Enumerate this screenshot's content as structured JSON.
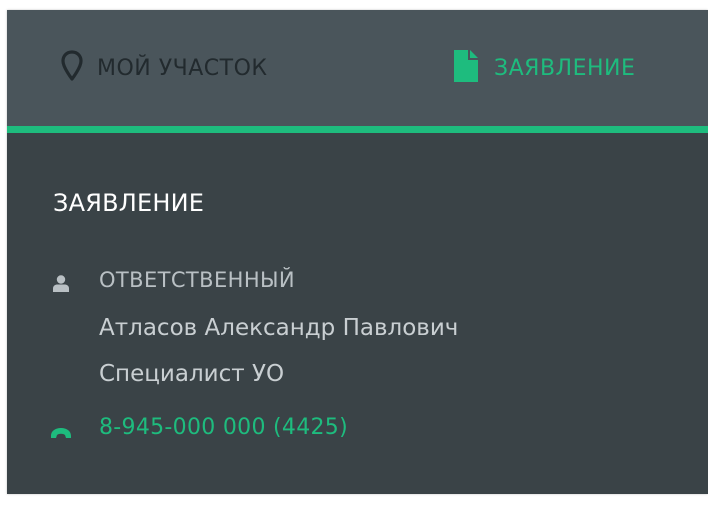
{
  "tabs": [
    {
      "label": "МОЙ УЧАСТОК",
      "icon": "map-marker-icon",
      "active": false
    },
    {
      "label": "ЗАЯВЛЕНИЕ",
      "icon": "document-icon",
      "active": true
    }
  ],
  "section": {
    "title": "ЗАЯВЛЕНИЕ",
    "responsible": {
      "label": "ОТВЕТСТВЕННЫЙ",
      "name": "Атласов Александр Павлович",
      "role": "Специалист УО",
      "phone": "8-945-000 000 (4425)"
    }
  },
  "colors": {
    "accent": "#1ebc7e",
    "tabbar_bg": "#4a555b",
    "panel_bg": "#3a4347",
    "inactive_tab_text": "#222a2e"
  }
}
